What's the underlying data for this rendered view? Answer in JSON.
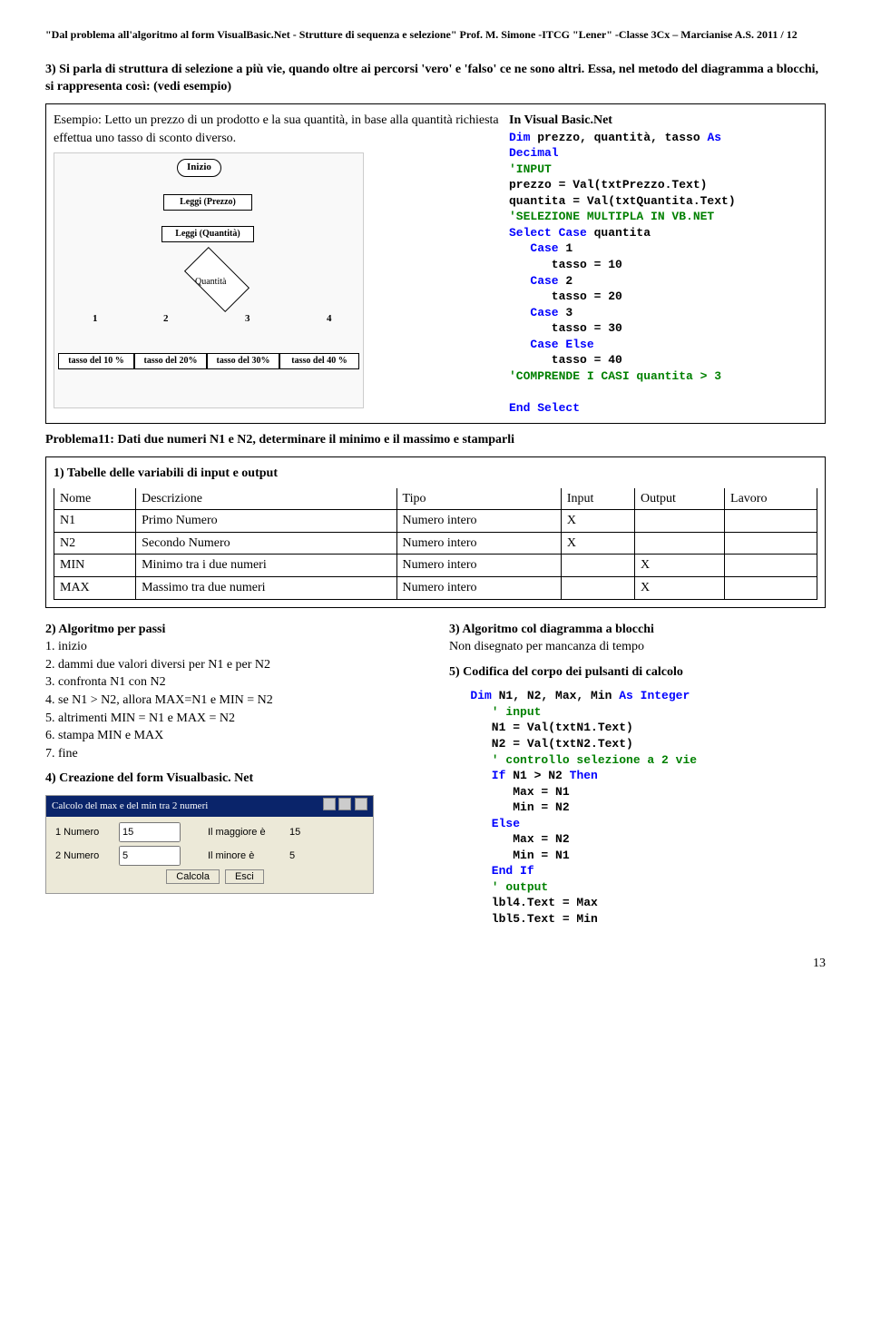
{
  "header": "\"Dal problema all'algoritmo al form VisualBasic.Net - Strutture di sequenza e selezione\" Prof. M. Simone -ITCG \"Lener\" -Classe 3Cx – Marcianise A.S. 2011 / 12",
  "intro": "3) Si parla di struttura di selezione a più vie, quando oltre ai percorsi 'vero' e 'falso' ce ne sono altri. Essa, nel metodo del diagramma a blocchi, si rappresenta così: (vedi esempio)",
  "example": {
    "left_text": "Esempio: Letto un prezzo di un prodotto e la sua quantità, in base alla quantità richiesta effettua uno tasso di sconto diverso.",
    "diagram": {
      "start": "Inizio",
      "read1": "Leggi (Prezzo)",
      "read2": "Leggi (Quantità)",
      "decision": "Quantità",
      "n1": "1",
      "n2": "2",
      "n3": "3",
      "n4": "4",
      "r1": "tasso del 10 %",
      "r2": "tasso del 20%",
      "r3": "tasso del 30%",
      "r4": "tasso del 40 %"
    },
    "right_title": "In Visual Basic.Net",
    "code": {
      "l1a": "Dim",
      "l1b": " prezzo, quantità, tasso ",
      "l1c": "As",
      "l2": "Decimal",
      "l3": "'INPUT",
      "l4": "prezzo = Val(txtPrezzo.Text)",
      "l5": "quantita = Val(txtQuantita.Text)",
      "l6": "'SELEZIONE MULTIPLA IN VB.NET",
      "l7a": "Select Case",
      "l7b": " quantita",
      "l8a": "   Case",
      "l8b": " 1",
      "l9": "      tasso = 10",
      "l10a": "   Case",
      "l10b": " 2",
      "l11": "      tasso = 20",
      "l12a": "   Case",
      "l12b": " 3",
      "l13": "      tasso = 30",
      "l14": "   Case Else",
      "l15": "      tasso = 40",
      "l16": "'COMPRENDE I CASI quantita > 3",
      "l17": "",
      "l18": "End Select"
    }
  },
  "prob_heading": "Problema11: Dati due numeri N1 e N2, determinare il minimo e il massimo e stamparli",
  "tbl_heading": "1) Tabelle delle variabili di input e output",
  "table": {
    "h1": "Nome",
    "h2": "Descrizione",
    "h3": "Tipo",
    "h4": "Input",
    "h5": "Output",
    "h6": "Lavoro",
    "r1c1": "N1",
    "r1c2": "Primo Numero",
    "r1c3": "Numero intero",
    "r1c4": "X",
    "r1c5": "",
    "r1c6": "",
    "r2c1": "N2",
    "r2c2": "Secondo Numero",
    "r2c3": "Numero intero",
    "r2c4": "X",
    "r2c5": "",
    "r2c6": "",
    "r3c1": "MIN",
    "r3c2": "Minimo tra i due numeri",
    "r3c3": "Numero intero",
    "r3c4": "",
    "r3c5": "X",
    "r3c6": "",
    "r4c1": "MAX",
    "r4c2": "Massimo tra  due numeri",
    "r4c3": "Numero intero",
    "r4c4": "",
    "r4c5": "X",
    "r4c6": ""
  },
  "algo": {
    "h": "2) Algoritmo per passi",
    "s1": "1. inizio",
    "s2": "2. dammi due valori diversi per N1 e per N2",
    "s3": "3. confronta N1 con N2",
    "s4": "4. se N1 > N2, allora MAX=N1 e MIN = N2",
    "s5": "5. altrimenti MIN = N1 e MAX = N2",
    "s6": "6. stampa MIN e MAX",
    "s7": "7. fine"
  },
  "form_heading": "4) Creazione del form Visualbasic. Net",
  "form": {
    "title": "Calcolo del max e del min tra 2 numeri",
    "l_n1": "1 Numero",
    "v_n1": "15",
    "l_n2": "2 Numero",
    "v_n2": "5",
    "l_max": "Il maggiore è",
    "v_max": "15",
    "l_min": "Il minore è",
    "v_min": "5",
    "btn_calc": "Calcola",
    "btn_exit": "Esci"
  },
  "right": {
    "h1": "3) Algoritmo col diagramma a blocchi",
    "note": "Non disegnato per mancanza di tempo",
    "h2": "5) Codifica del corpo dei pulsanti di calcolo",
    "c1a": "   Dim",
    "c1b": " N1, N2, Max, Min ",
    "c1c": "As Integer",
    "c2": "      ' input",
    "c3": "      N1 = Val(txtN1.Text)",
    "c4": "      N2 = Val(txtN2.Text)",
    "c5": "      ' controllo selezione a 2 vie",
    "c6a": "      If",
    "c6b": " N1 > N2 ",
    "c6c": "Then",
    "c7": "         Max = N1",
    "c8": "         Min = N2",
    "c9": "      Else",
    "c10": "         Max = N2",
    "c11": "         Min = N1",
    "c12": "      End If",
    "c13": "      ' output",
    "c14": "      lbl4.Text = Max",
    "c15": "      lbl5.Text = Min"
  },
  "pagenum": "13"
}
